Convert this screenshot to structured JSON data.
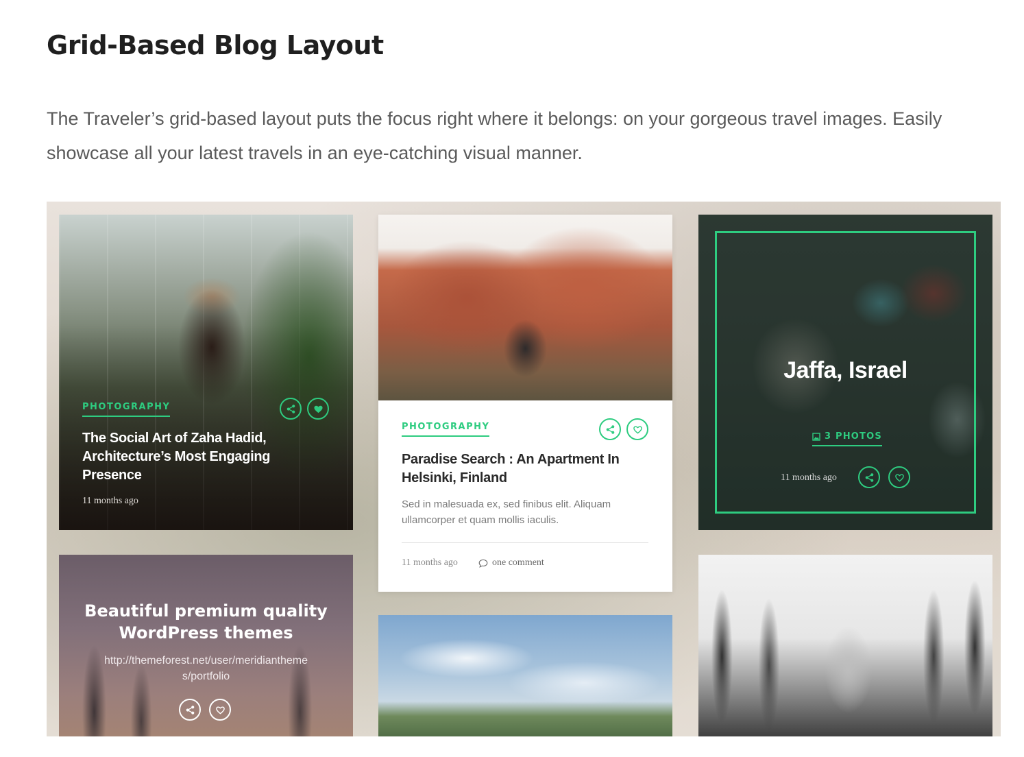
{
  "section": {
    "heading": "Grid-Based Blog Layout",
    "intro": "The Traveler’s grid-based layout puts the focus right where it belongs: on your gorgeous travel images. Easily showcase all your latest travels in an eye-catching visual manner."
  },
  "colors": {
    "accent": "#2ecc80",
    "heading": "#1f1f1f",
    "body_text": "#5a5a5a"
  },
  "posts": [
    {
      "category": "PHOTOGRAPHY",
      "title": "The Social Art of Zaha Hadid, Architecture’s Most Engaging Presence",
      "time": "11 months ago",
      "share_icon": "share-icon",
      "like_icon": "heart-icon"
    },
    {
      "category": "PHOTOGRAPHY",
      "title": "Paradise Search : An Apartment In Helsinki, Finland",
      "excerpt": "Sed in malesuada ex, sed finibus elit. Aliquam ullamcorper et quam mollis iaculis.",
      "time": "11 months ago",
      "comments": "one comment",
      "share_icon": "share-icon",
      "like_icon": "heart-icon"
    },
    {
      "place": "Jaffa, Israel",
      "photos": "3 PHOTOS",
      "time": "11 months ago",
      "share_icon": "share-icon",
      "like_icon": "heart-icon"
    }
  ],
  "promo": {
    "title": "Beautiful premium quality WordPress themes",
    "url": "http://themeforest.net/user/meridianthemes/portfolio"
  }
}
